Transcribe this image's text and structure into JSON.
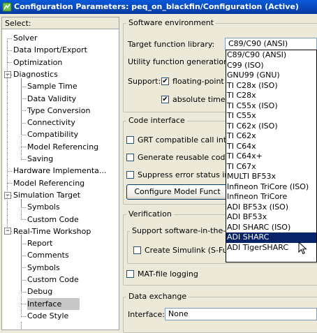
{
  "window": {
    "title": "Configuration Parameters: peq_on_blackfin/Configuration (Active)"
  },
  "select_header": "Select:",
  "tree": [
    {
      "label": "Solver",
      "level": 1
    },
    {
      "label": "Data Import/Export",
      "level": 1
    },
    {
      "label": "Optimization",
      "level": 1
    },
    {
      "label": "Diagnostics",
      "level": 1,
      "expanded": true
    },
    {
      "label": "Sample Time",
      "level": 2
    },
    {
      "label": "Data Validity",
      "level": 2
    },
    {
      "label": "Type Conversion",
      "level": 2
    },
    {
      "label": "Connectivity",
      "level": 2
    },
    {
      "label": "Compatibility",
      "level": 2
    },
    {
      "label": "Model Referencing",
      "level": 2
    },
    {
      "label": "Saving",
      "level": 2
    },
    {
      "label": "Hardware Implementa...",
      "level": 1
    },
    {
      "label": "Model Referencing",
      "level": 1
    },
    {
      "label": "Simulation Target",
      "level": 1,
      "expanded": true
    },
    {
      "label": "Symbols",
      "level": 2
    },
    {
      "label": "Custom Code",
      "level": 2
    },
    {
      "label": "Real-Time Workshop",
      "level": 1,
      "expanded": true
    },
    {
      "label": "Report",
      "level": 2
    },
    {
      "label": "Comments",
      "level": 2
    },
    {
      "label": "Symbols",
      "level": 2
    },
    {
      "label": "Custom Code",
      "level": 2
    },
    {
      "label": "Debug",
      "level": 2
    },
    {
      "label": "Interface",
      "level": 2,
      "selected": true
    },
    {
      "label": "Code Style",
      "level": 2
    }
  ],
  "software_env": {
    "title": "Software environment",
    "target_fn_label": "Target function library:",
    "target_fn_value": "C89/C90 (ANSI)",
    "utility_label": "Utility function generation:",
    "support_label": "Support:",
    "floating_point_label": "floating-point n",
    "floating_point_checked": true,
    "absolute_time_label": "absolute time",
    "absolute_time_checked": true
  },
  "code_interface": {
    "title": "Code interface",
    "grt_label": "GRT compatible call inter",
    "grt_checked": false,
    "reusable_label": "Generate reusable code",
    "reusable_checked": false,
    "suppress_label": "Suppress error status in",
    "suppress_checked": false,
    "configure_button": "Configure Model Funct"
  },
  "verification": {
    "title": "Verification",
    "support_sil_title": "Support software-in-the-lo",
    "create_simulink_label": "Create Simulink (S-Fun",
    "create_simulink_checked": false,
    "mat_logging_label": "MAT-file logging",
    "mat_logging_checked": false
  },
  "data_exchange": {
    "title": "Data exchange",
    "interface_label": "Interface:",
    "interface_value": "None"
  },
  "dropdown": {
    "highlighted_index": 18,
    "options": [
      "C89/C90 (ANSI)",
      "C99 (ISO)",
      "GNU99 (GNU)",
      "TI C28x (ISO)",
      "TI C28x",
      "TI C55x (ISO)",
      "TI C55x",
      "TI C62x (ISO)",
      "TI C62x",
      "TI C64x",
      "TI C64x+",
      "TI C67x",
      "MULTI BF53x",
      "Infineon TriCore (ISO)",
      "Infineon TriCore",
      "ADI BF53x (ISO)",
      "ADI BF53x",
      "ADI SHARC (ISO)",
      "ADI SHARC",
      "ADI TigerSHARC"
    ]
  },
  "colors": {
    "title_bar": "#0a59d9",
    "highlight": "#0a246a",
    "window_bg": "#ece9d8"
  }
}
